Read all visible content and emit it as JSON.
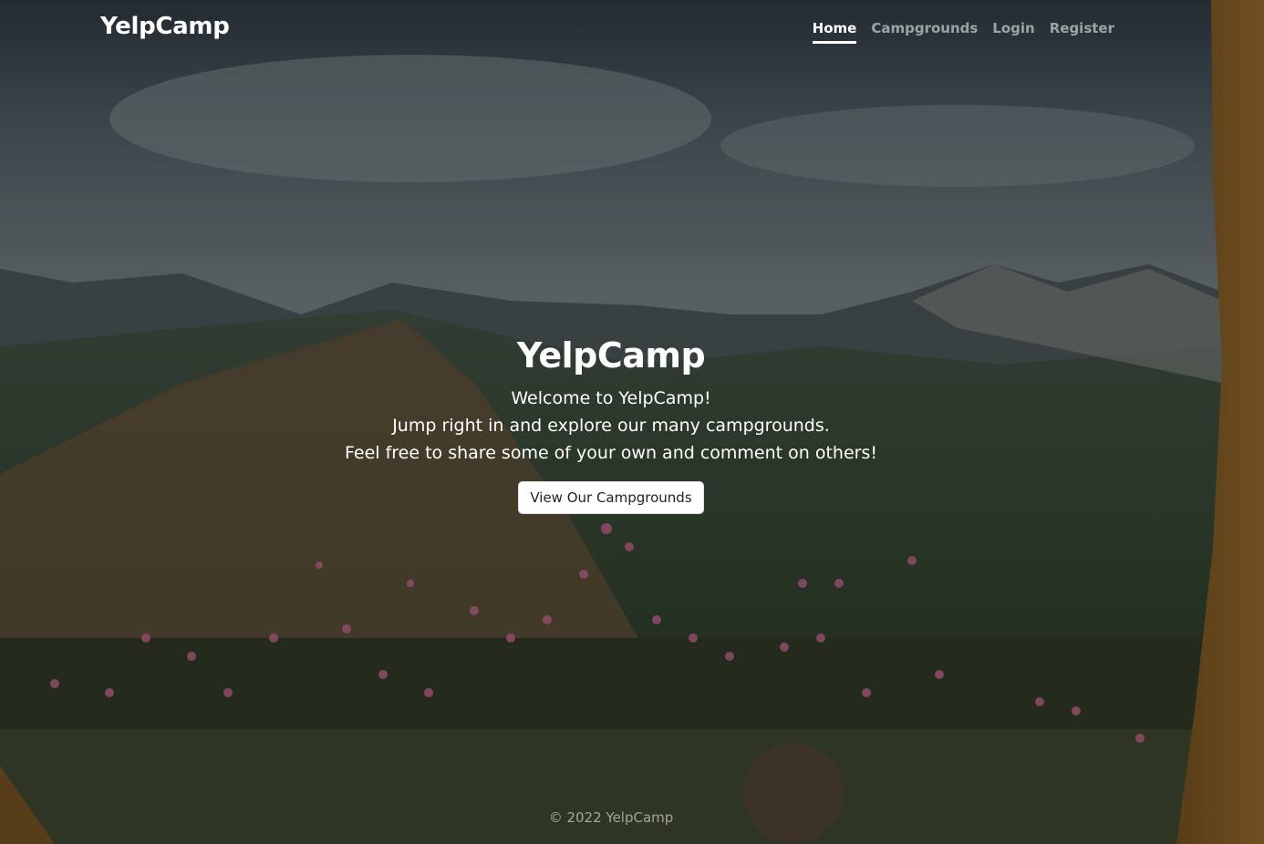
{
  "navbar": {
    "brand": "YelpCamp",
    "links": [
      {
        "label": "Home",
        "active": true
      },
      {
        "label": "Campgrounds",
        "active": false
      },
      {
        "label": "Login",
        "active": false
      },
      {
        "label": "Register",
        "active": false
      }
    ]
  },
  "hero": {
    "title": "YelpCamp",
    "lines": [
      "Welcome to YelpCamp!",
      "Jump right in and explore our many campgrounds.",
      "Feel free to share some of your own and comment on others!"
    ],
    "button_label": "View Our Campgrounds"
  },
  "footer": {
    "text": "© 2022 YelpCamp"
  }
}
